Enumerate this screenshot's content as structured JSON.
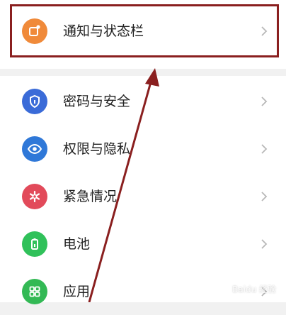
{
  "settings": {
    "items": [
      {
        "label": "通知与状态栏",
        "icon": "notification-icon",
        "color": "#f08a3a"
      },
      {
        "label": "密码与安全",
        "icon": "shield-icon",
        "color": "#3a6bd8"
      },
      {
        "label": "权限与隐私",
        "icon": "privacy-eye-icon",
        "color": "#2f78d8"
      },
      {
        "label": "紧急情况",
        "icon": "emergency-icon",
        "color": "#e24a5a"
      },
      {
        "label": "电池",
        "icon": "battery-icon",
        "color": "#30c15a"
      },
      {
        "label": "应用",
        "icon": "apps-grid-icon",
        "color": "#33b955"
      }
    ]
  },
  "annotation": {
    "color": "#8a1f1f"
  },
  "watermark": {
    "text": "Baidu 经验"
  }
}
